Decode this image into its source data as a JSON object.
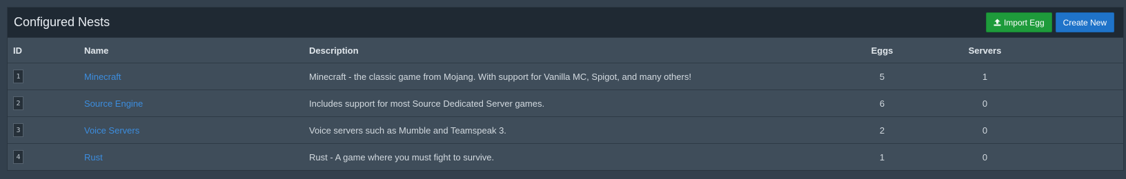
{
  "panel": {
    "title": "Configured Nests",
    "import_label": "Import Egg",
    "create_label": "Create New"
  },
  "table": {
    "headers": {
      "id": "ID",
      "name": "Name",
      "description": "Description",
      "eggs": "Eggs",
      "servers": "Servers"
    },
    "rows": [
      {
        "id": "1",
        "name": "Minecraft",
        "description": "Minecraft - the classic game from Mojang. With support for Vanilla MC, Spigot, and many others!",
        "eggs": "5",
        "servers": "1"
      },
      {
        "id": "2",
        "name": "Source Engine",
        "description": "Includes support for most Source Dedicated Server games.",
        "eggs": "6",
        "servers": "0"
      },
      {
        "id": "3",
        "name": "Voice Servers",
        "description": "Voice servers such as Mumble and Teamspeak 3.",
        "eggs": "2",
        "servers": "0"
      },
      {
        "id": "4",
        "name": "Rust",
        "description": "Rust - A game where you must fight to survive.",
        "eggs": "1",
        "servers": "0"
      }
    ]
  },
  "colors": {
    "background": "#33404d",
    "panel": "#3f4d5a",
    "header": "#1f2933",
    "import_button": "#1e9b3b",
    "create_button": "#1f73c9",
    "link": "#3c8dde"
  },
  "icons": {
    "import": "upload-icon"
  }
}
